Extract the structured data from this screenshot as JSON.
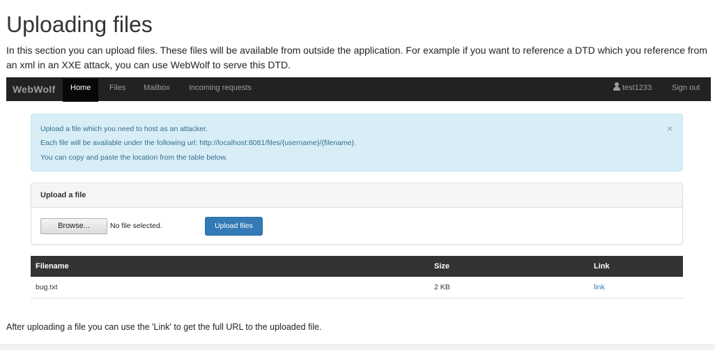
{
  "page": {
    "title": "Uploading files",
    "intro": "In this section you can upload files. These files will be available from outside the application. For example if you want to reference a DTD which you reference from an xml in an XXE attack, you can use WebWolf to serve this DTD.",
    "footer_note": "After uploading a file you can use the 'Link' to get the full URL to the uploaded file."
  },
  "navbar": {
    "brand": "WebWolf",
    "items": [
      {
        "label": "Home",
        "active": true
      },
      {
        "label": "Files"
      },
      {
        "label": "Mailbox"
      },
      {
        "label": "Incoming requests"
      }
    ],
    "user": "test1233",
    "user_icon": "user-icon",
    "signout": "Sign out"
  },
  "alert": {
    "lines": [
      "Upload a file which you need to host as an attacker.",
      "Each file will be available under the following url: http://localhost:8081/files/{username}/{filename}.",
      "You can copy and paste the location from the table below."
    ],
    "close": "×"
  },
  "upload_panel": {
    "heading": "Upload a file",
    "browse_label": "Browse...",
    "no_file": "No file selected.",
    "upload_label": "Upload files"
  },
  "table": {
    "headers": [
      "Filename",
      "Size",
      "Link"
    ],
    "rows": [
      {
        "filename": "bug.txt",
        "size": "2 KB",
        "link": "link"
      }
    ]
  },
  "colors": {
    "navbar_bg": "#222222",
    "alert_bg": "#d9edf7",
    "alert_text": "#31708f",
    "primary_button": "#337ab7",
    "table_header_bg": "#333333"
  }
}
